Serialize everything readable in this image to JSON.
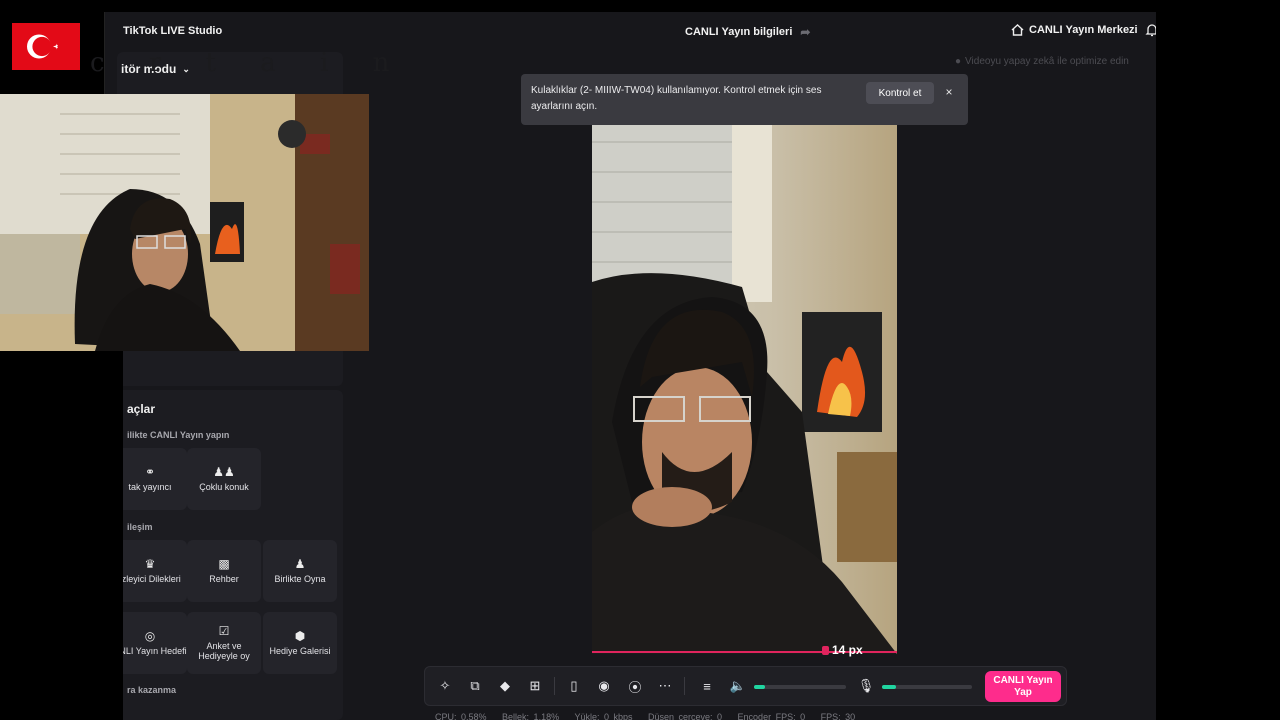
{
  "app": {
    "title": "TikTok LIVE Studio",
    "center_title": "CANLI Yayın bilgileri",
    "live_center": "CANLI Yayın Merkezi",
    "mode_label": "itör modu",
    "ai_hint": "Videoyu yapay zekâ ile optimize edin"
  },
  "notification": {
    "text": "Kulaklıklar (2- MIIIW-TW04) kullanılamıyor. Kontrol etmek için ses ayarlarını açın.",
    "action": "Kontrol et",
    "close": "×"
  },
  "tools": {
    "title": "açlar",
    "sections": [
      {
        "label": "ilikte CANLI Yayın yapın"
      },
      {
        "label": "ileşim"
      },
      {
        "label": "ra kazanma"
      }
    ],
    "items": [
      {
        "label": "tak yayıncı",
        "icon": "link-icon"
      },
      {
        "label": "Çoklu konuk",
        "icon": "users-icon"
      },
      {
        "label": "İzleyici Dilekleri",
        "icon": "wishes-icon"
      },
      {
        "label": "Rehber",
        "icon": "guide-icon"
      },
      {
        "label": "Birlikte Oyna",
        "icon": "play-together-icon"
      },
      {
        "label": "ANLI Yayın Hedefi",
        "icon": "goal-icon"
      },
      {
        "label": "Anket ve Hediyeyle oy",
        "icon": "poll-icon"
      },
      {
        "label": "Hediye Galerisi",
        "icon": "gift-gallery-icon"
      }
    ]
  },
  "preview": {
    "size_label": "14 px"
  },
  "controls": {
    "go_live": "CANLI Yayın Yap",
    "volume_level": 0.12,
    "mic_level": 0.16,
    "accent": "#20d5a0",
    "live_color": "#fe2c8c"
  },
  "stats": {
    "cpu": "CPU: 0.58%",
    "memory": "Bellek: 1.18%",
    "upload": "Yükle: 0 kbps",
    "dropped": "Düşen çerçeve: 0",
    "encoder_fps": "Encoder FPS: 0",
    "fps": "FPS: 30"
  },
  "overlay": {
    "watermark": "c r t a i n"
  }
}
